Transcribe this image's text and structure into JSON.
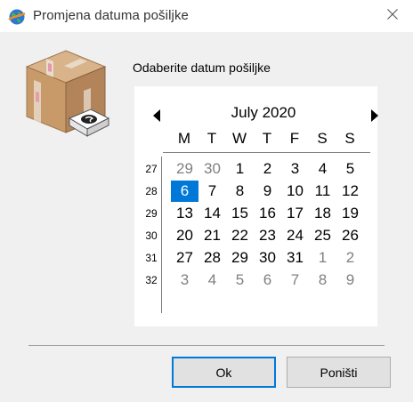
{
  "window": {
    "title": "Promjena datuma pošiljke"
  },
  "dialog": {
    "prompt": "Odaberite datum pošiljke",
    "ok_label": "Ok",
    "cancel_label": "Poništi"
  },
  "calendar": {
    "month_label": "July 2020",
    "weekdays": [
      "M",
      "T",
      "W",
      "T",
      "F",
      "S",
      "S"
    ],
    "weeks": [
      {
        "number": "27",
        "days": [
          {
            "d": "29",
            "other": true
          },
          {
            "d": "30",
            "other": true
          },
          {
            "d": "1"
          },
          {
            "d": "2"
          },
          {
            "d": "3"
          },
          {
            "d": "4"
          },
          {
            "d": "5"
          }
        ]
      },
      {
        "number": "28",
        "days": [
          {
            "d": "6",
            "selected": true
          },
          {
            "d": "7"
          },
          {
            "d": "8"
          },
          {
            "d": "9"
          },
          {
            "d": "10"
          },
          {
            "d": "11"
          },
          {
            "d": "12"
          }
        ]
      },
      {
        "number": "29",
        "days": [
          {
            "d": "13"
          },
          {
            "d": "14"
          },
          {
            "d": "15"
          },
          {
            "d": "16"
          },
          {
            "d": "17"
          },
          {
            "d": "18"
          },
          {
            "d": "19"
          }
        ]
      },
      {
        "number": "30",
        "days": [
          {
            "d": "20"
          },
          {
            "d": "21"
          },
          {
            "d": "22"
          },
          {
            "d": "23"
          },
          {
            "d": "24"
          },
          {
            "d": "25"
          },
          {
            "d": "26"
          }
        ]
      },
      {
        "number": "31",
        "days": [
          {
            "d": "27"
          },
          {
            "d": "28"
          },
          {
            "d": "29"
          },
          {
            "d": "30"
          },
          {
            "d": "31"
          },
          {
            "d": "1",
            "other": true
          },
          {
            "d": "2",
            "other": true
          }
        ]
      },
      {
        "number": "32",
        "days": [
          {
            "d": "3",
            "other": true
          },
          {
            "d": "4",
            "other": true
          },
          {
            "d": "5",
            "other": true
          },
          {
            "d": "6",
            "other": true
          },
          {
            "d": "7",
            "other": true
          },
          {
            "d": "8",
            "other": true
          },
          {
            "d": "9",
            "other": true
          }
        ]
      }
    ],
    "selected_day": "6",
    "colors": {
      "selection": "#0078d7",
      "other_month": "#808080"
    }
  },
  "icons": {
    "app": "app-globe-icon",
    "close": "close-icon",
    "package": "package-box-icon",
    "prev": "prev-month-arrow-icon",
    "next": "next-month-arrow-icon"
  }
}
